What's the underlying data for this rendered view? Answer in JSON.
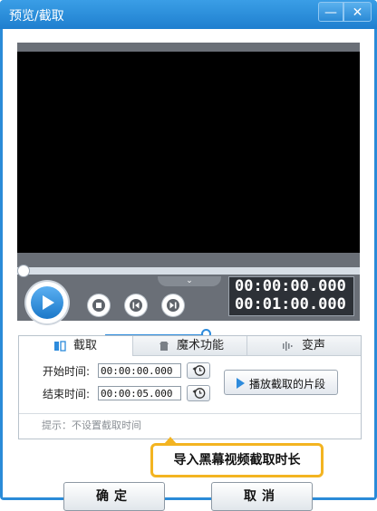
{
  "window": {
    "title": "预览/截取",
    "minimize_label": "—",
    "close_label": "✕"
  },
  "player": {
    "current_time": "00:00:00.000",
    "total_time": "00:01:00.000",
    "collapse_icon": "chevron-down-icon",
    "volume_level": 0.95,
    "accent_color": "#2d8bdc"
  },
  "tabs": [
    {
      "label": "截取",
      "icon": "cut-icon"
    },
    {
      "label": "魔术功能",
      "icon": "magic-icon"
    },
    {
      "label": "变声",
      "icon": "voice-icon"
    }
  ],
  "clip": {
    "start_label": "开始时间:",
    "start_value": "00:00:00.000",
    "end_label": "结束时间:",
    "end_value": "00:00:05.000",
    "play_segment_label": "播放截取的片段",
    "hint": "提示：不设置截取时间"
  },
  "tooltip": {
    "text": "导入黑幕视频截取时长",
    "border_color": "#f3b421"
  },
  "buttons": {
    "ok_label": "确定",
    "cancel_label": "取消"
  }
}
